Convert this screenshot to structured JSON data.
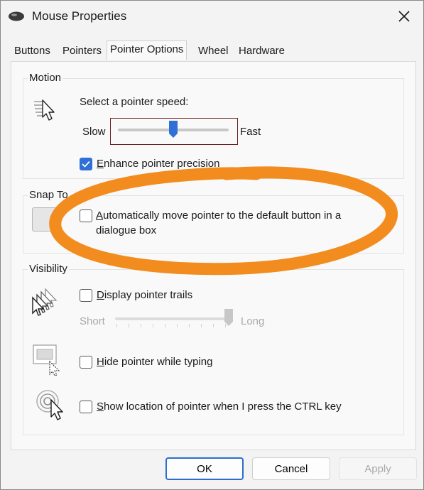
{
  "window": {
    "title": "Mouse Properties",
    "icon": "mouse-icon"
  },
  "tabs": [
    {
      "label": "Buttons",
      "active": false
    },
    {
      "label": "Pointers",
      "active": false
    },
    {
      "label": "Pointer Options",
      "active": true
    },
    {
      "label": "Wheel",
      "active": false
    },
    {
      "label": "Hardware",
      "active": false
    }
  ],
  "motion": {
    "group_label": "Motion",
    "speed_label": "Select a pointer speed:",
    "slow_label": "Slow",
    "fast_label": "Fast",
    "speed_fraction": 0.5,
    "enhance_precision": {
      "label": "Enhance pointer precision",
      "checked": true,
      "access_key": "E"
    }
  },
  "snap_to": {
    "group_label": "Snap To",
    "auto_move": {
      "label_line1": "Automatically move pointer to the default button in a",
      "label_line2": "dialogue box",
      "checked": false,
      "access_key": "A"
    }
  },
  "visibility": {
    "group_label": "Visibility",
    "pointer_trails": {
      "label": "Display pointer trails",
      "checked": false,
      "access_key": "D"
    },
    "short_label": "Short",
    "long_label": "Long",
    "trail_fraction": 1.0,
    "hide_while_typing": {
      "label": "Hide pointer while typing",
      "checked": false,
      "access_key": "H"
    },
    "show_location": {
      "label": "Show location of pointer when I press the CTRL key",
      "checked": false,
      "access_key": "S"
    }
  },
  "buttons": {
    "ok": "OK",
    "cancel": "Cancel",
    "apply": "Apply"
  },
  "colors": {
    "accent": "#2f6fd6",
    "annotation": "#f28c1e"
  }
}
